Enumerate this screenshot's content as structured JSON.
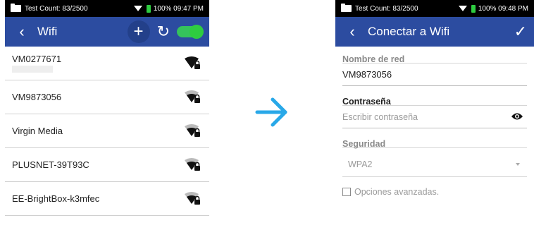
{
  "left": {
    "status": {
      "test_count": "Test Count: 83/2500",
      "battery_time": "100% 09:47 PM"
    },
    "appbar": {
      "back_icon": "chevron-left-icon",
      "title": "Wifi",
      "add_icon": "plus-icon",
      "refresh_icon": "refresh-icon",
      "toggle": "on"
    },
    "networks": [
      {
        "name": "VM0277671",
        "signal": "strong-locked"
      },
      {
        "name": "VM9873056",
        "signal": "medium-locked"
      },
      {
        "name": "Virgin Media",
        "signal": "medium-locked"
      },
      {
        "name": "PLUSNET-39T93C",
        "signal": "medium-locked"
      },
      {
        "name": "EE-BrightBox-k3mfec",
        "signal": "medium-locked"
      }
    ]
  },
  "transition_icon": "arrow-right-icon",
  "right": {
    "status": {
      "test_count": "Test Count: 83/2500",
      "battery_time": "100% 09:48 PM"
    },
    "appbar": {
      "back_icon": "chevron-left-icon",
      "title": "Conectar a Wifi",
      "confirm_icon": "check-icon"
    },
    "form": {
      "network_label": "Nombre de red",
      "network_value": "VM9873056",
      "password_label": "Contraseña",
      "password_placeholder": "Escribir contraseña",
      "security_label": "Seguridad",
      "security_value": "WPA2",
      "advanced_label": "Opciones avanzadas."
    }
  },
  "colors": {
    "appbar": "#2c4ca0",
    "toggle": "#2ecc40",
    "arrow": "#29a8e8"
  }
}
